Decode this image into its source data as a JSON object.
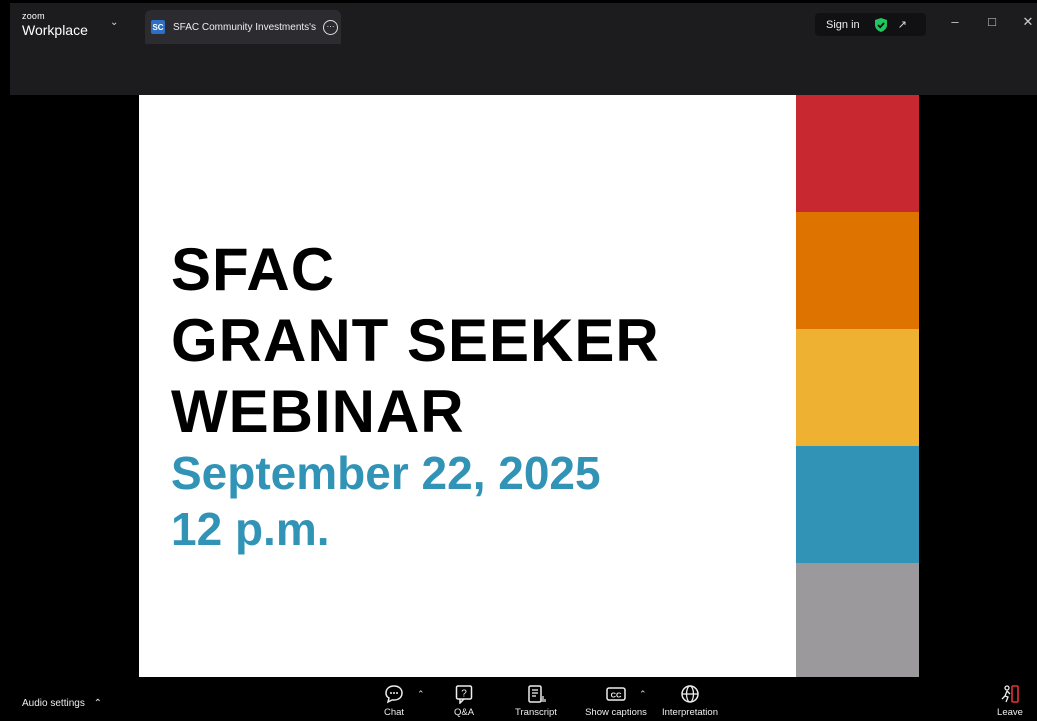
{
  "app": {
    "brand_small": "zoom",
    "brand_name": "Workplace"
  },
  "tab": {
    "avatar_initials": "SC",
    "title": "SFAC Community Investments's s"
  },
  "header": {
    "sign_in": "Sign in"
  },
  "slide": {
    "title_lines": [
      "SFAC",
      "GRANT SEEKER",
      "WEBINAR"
    ],
    "date_lines": [
      "September 22, 2025",
      "12 p.m."
    ],
    "bands": [
      "#c8282f",
      "#de7300",
      "#efb131",
      "#3193b6",
      "#9b999b"
    ]
  },
  "toolbar": {
    "audio_settings": "Audio settings",
    "chat": "Chat",
    "qa": "Q&A",
    "transcript": "Transcript",
    "show_captions": "Show captions",
    "interpretation": "Interpretation",
    "leave": "Leave"
  },
  "colors": {
    "accent_text": "#3193b6",
    "leave_red": "#e0323a",
    "shield_green": "#22c55e"
  }
}
